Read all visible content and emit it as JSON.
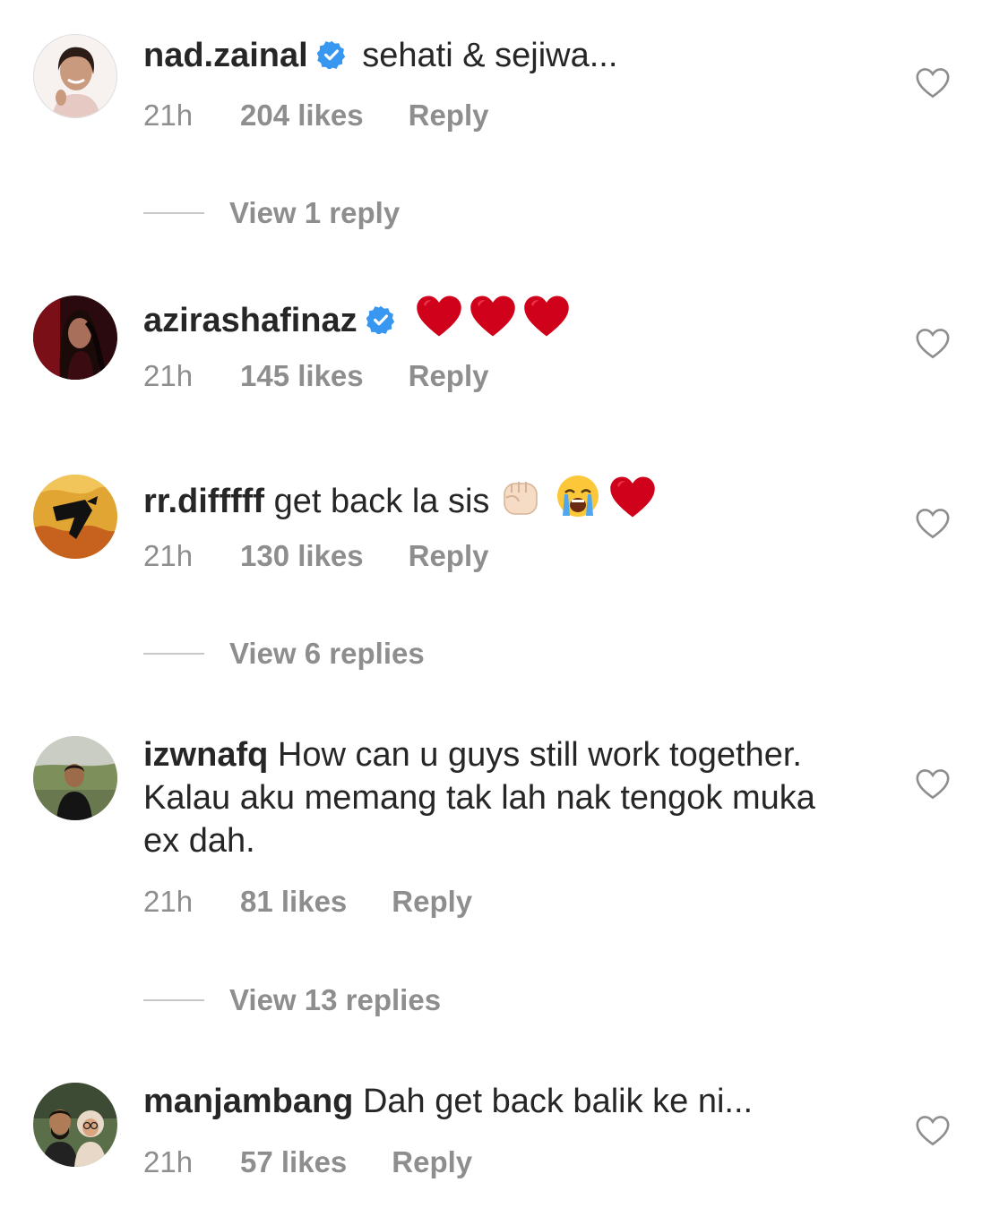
{
  "comments": [
    {
      "username": "nad.zainal",
      "verified": true,
      "text": "sehati & sejiwa...",
      "time": "21h",
      "likes": "204 likes",
      "reply": "Reply",
      "view_replies": "View 1 reply"
    },
    {
      "username": "azirashafinaz",
      "verified": true,
      "text": "",
      "emojis": [
        "red-heart",
        "red-heart",
        "red-heart"
      ],
      "time": "21h",
      "likes": "145 likes",
      "reply": "Reply"
    },
    {
      "username": "rr.difffff",
      "verified": false,
      "text": "get back la sis",
      "emojis": [
        "raised-fist",
        "loudly-crying-face",
        "red-heart"
      ],
      "time": "21h",
      "likes": "130 likes",
      "reply": "Reply",
      "view_replies": "View 6 replies"
    },
    {
      "username": "izwnafq",
      "verified": false,
      "text": "How can u guys still work together. Kalau aku memang tak lah nak tengok muka ex dah.",
      "time": "21h",
      "likes": "81 likes",
      "reply": "Reply",
      "view_replies": "View 13 replies"
    },
    {
      "username": "manjambang",
      "verified": false,
      "text": "Dah get back balik ke ni...",
      "time": "21h",
      "likes": "57 likes",
      "reply": "Reply"
    }
  ],
  "colors": {
    "text": "#262626",
    "secondary": "#8e8e8e",
    "verified": "#3897f0",
    "heart_emoji": "#d0021b"
  }
}
